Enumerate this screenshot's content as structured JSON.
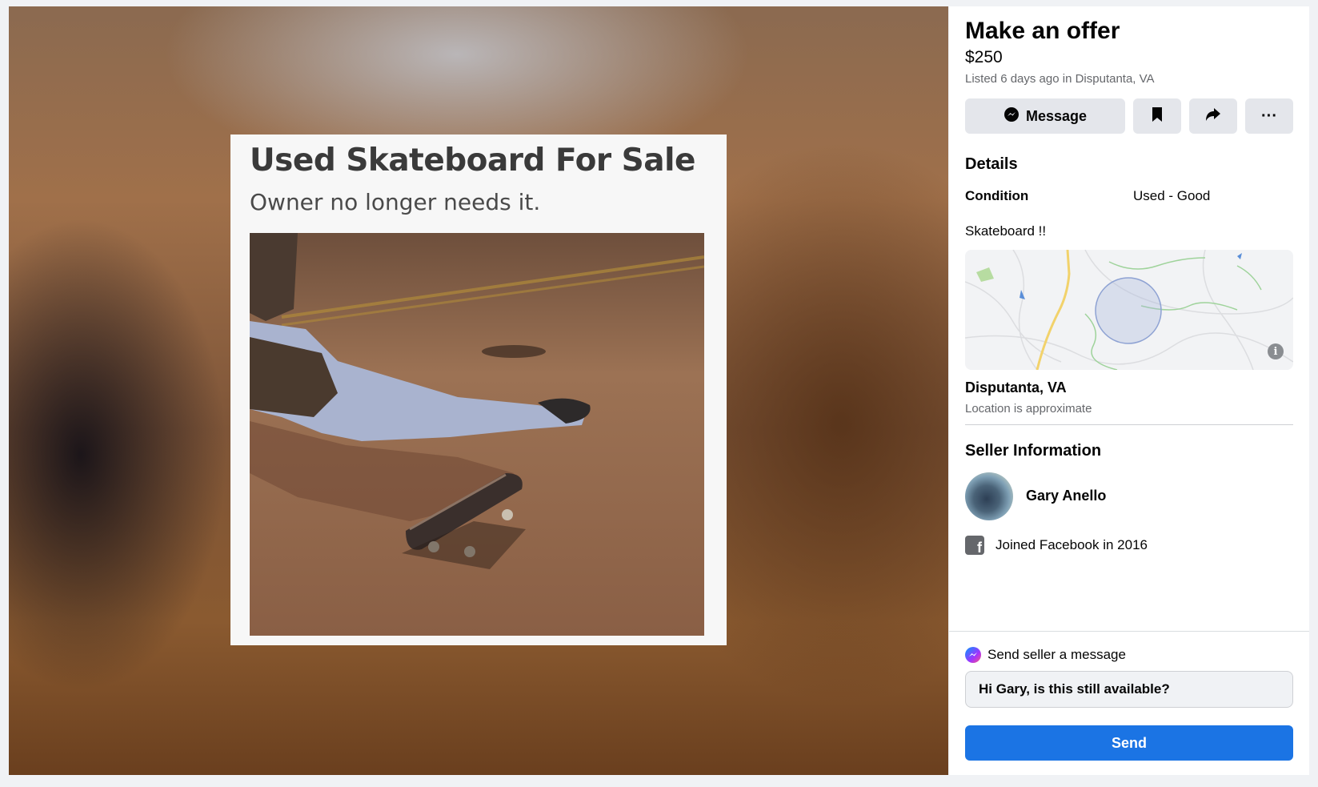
{
  "listing": {
    "image_headline": "Used Skateboard For Sale",
    "image_subline": "Owner no longer needs it."
  },
  "panel": {
    "title": "Make an offer",
    "price": "$250",
    "listed_text": "Listed 6 days ago in Disputanta, VA",
    "buttons": {
      "message_label": "Message",
      "save_icon": "bookmark-icon",
      "share_icon": "share-icon",
      "more_label": "···"
    },
    "details_heading": "Details",
    "condition_label": "Condition",
    "condition_value": "Used - Good",
    "description": "Skateboard !!",
    "map": {
      "info_label": "i",
      "location": "Disputanta, VA",
      "location_note": "Location is approximate"
    },
    "seller": {
      "heading": "Seller Information",
      "name": "Gary Anello",
      "joined": "Joined Facebook in 2016"
    },
    "message_box": {
      "label": "Send seller a message",
      "value": "Hi Gary, is this still available?",
      "send_label": "Send"
    }
  },
  "colors": {
    "primary_blue": "#1b74e4",
    "button_gray": "#e4e6eb",
    "secondary_text": "#65676b",
    "page_background": "#f0f2f5"
  }
}
